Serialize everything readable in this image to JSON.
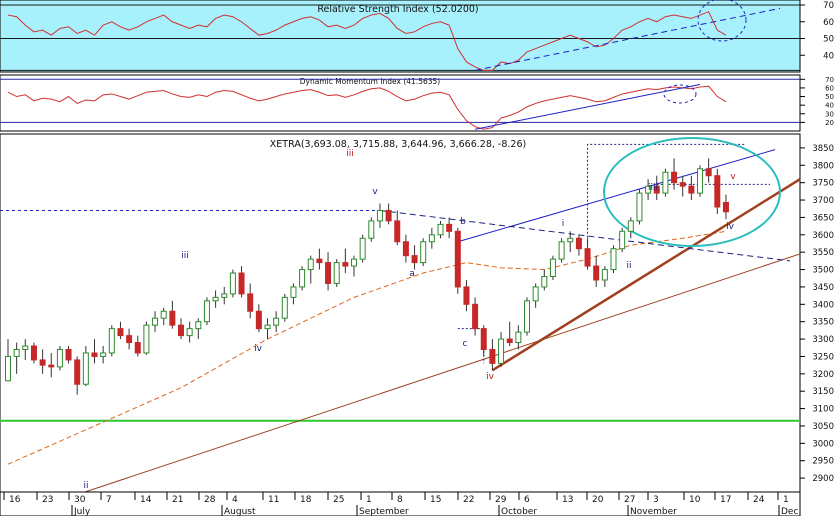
{
  "rsi_panel": {
    "title": "Relative Strength Index (52.0200)",
    "ticks": [
      70,
      60,
      50,
      40
    ]
  },
  "dmi_panel": {
    "title": "Dynamic Momentum Index (41.5635)",
    "ticks": [
      70,
      60,
      50,
      40,
      30,
      20
    ]
  },
  "price_panel": {
    "title": "XETRA(3,693.08, 3,715.88, 3,644.96, 3,666.28, -8.26)",
    "ticks": [
      3850,
      3800,
      3750,
      3700,
      3650,
      3600,
      3550,
      3500,
      3450,
      3400,
      3350,
      3300,
      3250,
      3200,
      3150,
      3100,
      3050,
      3000,
      2950,
      2900
    ]
  },
  "date_axis": {
    "days": [
      "16",
      "23",
      "30",
      "7",
      "14",
      "21",
      "28",
      "4",
      "11",
      "18",
      "25",
      "1",
      "8",
      "15",
      "22",
      "29",
      "6",
      "13",
      "20",
      "27",
      "3",
      "10",
      "17",
      "24",
      "1"
    ],
    "months": [
      "July",
      "August",
      "September",
      "October",
      "November",
      "Dec"
    ]
  },
  "wave_labels": [
    {
      "text": "ii",
      "color": "#1a237e"
    },
    {
      "text": "iii",
      "color": "#1a237e"
    },
    {
      "text": "iv",
      "color": "#1a237e"
    },
    {
      "text": "iii",
      "color": "#b71c1c"
    },
    {
      "text": "v",
      "color": "#1a237e"
    },
    {
      "text": "a",
      "color": "#1a237e"
    },
    {
      "text": "b",
      "color": "#1a237e"
    },
    {
      "text": "c",
      "color": "#1a237e"
    },
    {
      "text": "iv",
      "color": "#b71c1c"
    },
    {
      "text": "i",
      "color": "#1a237e"
    },
    {
      "text": "ii",
      "color": "#1a237e"
    },
    {
      "text": "iiii",
      "color": "#1a237e"
    },
    {
      "text": "v",
      "color": "#b71c1c"
    },
    {
      "text": "iv",
      "color": "#1a237e"
    }
  ],
  "colors": {
    "rsi_bg": "#a7f1fc",
    "price_bg": "#ffffff",
    "bull": "#2e8b2e",
    "bear": "#c62828",
    "indicator_line": "#d32f2f",
    "trend_blue": "#1f1fc8",
    "trend_brown": "#a0401e",
    "support_green": "#2ec82e",
    "ellipse": "#2bbdbd"
  },
  "chart_data": {
    "type": "candlestick",
    "title": "XETRA(3,693.08, 3,715.88, 3,644.96, 3,666.28, -8.26)",
    "ylim": [
      2860,
      3890
    ],
    "x_range": [
      "16 Jul",
      "1 Dec"
    ],
    "ohlc": [
      {
        "o": 3180,
        "h": 3300,
        "l": 3180,
        "c": 3250
      },
      {
        "o": 3250,
        "h": 3290,
        "l": 3200,
        "c": 3270
      },
      {
        "o": 3270,
        "h": 3300,
        "l": 3240,
        "c": 3280
      },
      {
        "o": 3280,
        "h": 3290,
        "l": 3230,
        "c": 3240
      },
      {
        "o": 3240,
        "h": 3270,
        "l": 3200,
        "c": 3225
      },
      {
        "o": 3225,
        "h": 3260,
        "l": 3190,
        "c": 3220
      },
      {
        "o": 3220,
        "h": 3280,
        "l": 3210,
        "c": 3270
      },
      {
        "o": 3270,
        "h": 3280,
        "l": 3230,
        "c": 3240
      },
      {
        "o": 3240,
        "h": 3250,
        "l": 3140,
        "c": 3170
      },
      {
        "o": 3170,
        "h": 3280,
        "l": 3165,
        "c": 3260
      },
      {
        "o": 3260,
        "h": 3300,
        "l": 3230,
        "c": 3250
      },
      {
        "o": 3250,
        "h": 3280,
        "l": 3230,
        "c": 3260
      },
      {
        "o": 3260,
        "h": 3340,
        "l": 3250,
        "c": 3330
      },
      {
        "o": 3330,
        "h": 3350,
        "l": 3300,
        "c": 3310
      },
      {
        "o": 3310,
        "h": 3330,
        "l": 3270,
        "c": 3290
      },
      {
        "o": 3290,
        "h": 3310,
        "l": 3250,
        "c": 3260
      },
      {
        "o": 3260,
        "h": 3350,
        "l": 3255,
        "c": 3340
      },
      {
        "o": 3340,
        "h": 3380,
        "l": 3320,
        "c": 3360
      },
      {
        "o": 3360,
        "h": 3390,
        "l": 3340,
        "c": 3380
      },
      {
        "o": 3380,
        "h": 3410,
        "l": 3330,
        "c": 3340
      },
      {
        "o": 3340,
        "h": 3360,
        "l": 3300,
        "c": 3310
      },
      {
        "o": 3310,
        "h": 3350,
        "l": 3290,
        "c": 3330
      },
      {
        "o": 3330,
        "h": 3360,
        "l": 3300,
        "c": 3350
      },
      {
        "o": 3350,
        "h": 3420,
        "l": 3340,
        "c": 3410
      },
      {
        "o": 3410,
        "h": 3440,
        "l": 3390,
        "c": 3420
      },
      {
        "o": 3420,
        "h": 3450,
        "l": 3400,
        "c": 3430
      },
      {
        "o": 3430,
        "h": 3500,
        "l": 3420,
        "c": 3490
      },
      {
        "o": 3490,
        "h": 3510,
        "l": 3420,
        "c": 3430
      },
      {
        "o": 3430,
        "h": 3460,
        "l": 3360,
        "c": 3380
      },
      {
        "o": 3380,
        "h": 3400,
        "l": 3320,
        "c": 3330
      },
      {
        "o": 3330,
        "h": 3360,
        "l": 3300,
        "c": 3340
      },
      {
        "o": 3340,
        "h": 3380,
        "l": 3320,
        "c": 3360
      },
      {
        "o": 3360,
        "h": 3430,
        "l": 3350,
        "c": 3420
      },
      {
        "o": 3420,
        "h": 3460,
        "l": 3400,
        "c": 3450
      },
      {
        "o": 3450,
        "h": 3510,
        "l": 3440,
        "c": 3500
      },
      {
        "o": 3500,
        "h": 3540,
        "l": 3460,
        "c": 3530
      },
      {
        "o": 3530,
        "h": 3560,
        "l": 3500,
        "c": 3520
      },
      {
        "o": 3520,
        "h": 3550,
        "l": 3440,
        "c": 3460
      },
      {
        "o": 3460,
        "h": 3530,
        "l": 3450,
        "c": 3520
      },
      {
        "o": 3520,
        "h": 3560,
        "l": 3490,
        "c": 3510
      },
      {
        "o": 3510,
        "h": 3540,
        "l": 3480,
        "c": 3530
      },
      {
        "o": 3530,
        "h": 3600,
        "l": 3520,
        "c": 3590
      },
      {
        "o": 3590,
        "h": 3650,
        "l": 3580,
        "c": 3640
      },
      {
        "o": 3640,
        "h": 3690,
        "l": 3620,
        "c": 3670
      },
      {
        "o": 3670,
        "h": 3690,
        "l": 3630,
        "c": 3640
      },
      {
        "o": 3640,
        "h": 3670,
        "l": 3570,
        "c": 3580
      },
      {
        "o": 3580,
        "h": 3600,
        "l": 3520,
        "c": 3540
      },
      {
        "o": 3540,
        "h": 3570,
        "l": 3500,
        "c": 3520
      },
      {
        "o": 3520,
        "h": 3590,
        "l": 3510,
        "c": 3580
      },
      {
        "o": 3580,
        "h": 3620,
        "l": 3560,
        "c": 3600
      },
      {
        "o": 3600,
        "h": 3640,
        "l": 3590,
        "c": 3630
      },
      {
        "o": 3630,
        "h": 3650,
        "l": 3590,
        "c": 3610
      },
      {
        "o": 3610,
        "h": 3620,
        "l": 3430,
        "c": 3450
      },
      {
        "o": 3450,
        "h": 3470,
        "l": 3380,
        "c": 3400
      },
      {
        "o": 3400,
        "h": 3420,
        "l": 3310,
        "c": 3330
      },
      {
        "o": 3330,
        "h": 3340,
        "l": 3250,
        "c": 3270
      },
      {
        "o": 3270,
        "h": 3300,
        "l": 3210,
        "c": 3230
      },
      {
        "o": 3230,
        "h": 3320,
        "l": 3220,
        "c": 3300
      },
      {
        "o": 3300,
        "h": 3350,
        "l": 3280,
        "c": 3290
      },
      {
        "o": 3290,
        "h": 3340,
        "l": 3270,
        "c": 3320
      },
      {
        "o": 3320,
        "h": 3420,
        "l": 3310,
        "c": 3410
      },
      {
        "o": 3410,
        "h": 3460,
        "l": 3390,
        "c": 3450
      },
      {
        "o": 3450,
        "h": 3500,
        "l": 3440,
        "c": 3480
      },
      {
        "o": 3480,
        "h": 3540,
        "l": 3470,
        "c": 3530
      },
      {
        "o": 3530,
        "h": 3590,
        "l": 3520,
        "c": 3580
      },
      {
        "o": 3580,
        "h": 3610,
        "l": 3550,
        "c": 3590
      },
      {
        "o": 3590,
        "h": 3600,
        "l": 3540,
        "c": 3560
      },
      {
        "o": 3560,
        "h": 3590,
        "l": 3500,
        "c": 3510
      },
      {
        "o": 3510,
        "h": 3540,
        "l": 3450,
        "c": 3470
      },
      {
        "o": 3470,
        "h": 3510,
        "l": 3450,
        "c": 3500
      },
      {
        "o": 3500,
        "h": 3570,
        "l": 3490,
        "c": 3560
      },
      {
        "o": 3560,
        "h": 3620,
        "l": 3550,
        "c": 3610
      },
      {
        "o": 3610,
        "h": 3650,
        "l": 3590,
        "c": 3640
      },
      {
        "o": 3640,
        "h": 3730,
        "l": 3630,
        "c": 3720
      },
      {
        "o": 3720,
        "h": 3760,
        "l": 3700,
        "c": 3740
      },
      {
        "o": 3740,
        "h": 3770,
        "l": 3700,
        "c": 3720
      },
      {
        "o": 3720,
        "h": 3790,
        "l": 3710,
        "c": 3780
      },
      {
        "o": 3780,
        "h": 3820,
        "l": 3730,
        "c": 3750
      },
      {
        "o": 3750,
        "h": 3770,
        "l": 3710,
        "c": 3740
      },
      {
        "o": 3740,
        "h": 3770,
        "l": 3700,
        "c": 3720
      },
      {
        "o": 3720,
        "h": 3800,
        "l": 3710,
        "c": 3790
      },
      {
        "o": 3790,
        "h": 3820,
        "l": 3750,
        "c": 3770
      },
      {
        "o": 3770,
        "h": 3790,
        "l": 3660,
        "c": 3680
      },
      {
        "o": 3693.08,
        "h": 3715.88,
        "l": 3644.96,
        "c": 3666.28
      }
    ],
    "moving_average": [
      [
        0,
        2940
      ],
      [
        10,
        3050
      ],
      [
        20,
        3160
      ],
      [
        30,
        3300
      ],
      [
        40,
        3420
      ],
      [
        48,
        3490
      ],
      [
        53,
        3520
      ],
      [
        57,
        3505
      ],
      [
        62,
        3500
      ],
      [
        67,
        3530
      ],
      [
        72,
        3570
      ],
      [
        78,
        3590
      ],
      [
        83,
        3610
      ]
    ],
    "rsi": {
      "ylim": [
        30,
        73
      ],
      "ticks": [
        70,
        60,
        50,
        40
      ],
      "values": [
        64,
        63,
        58,
        54,
        55,
        52,
        56,
        57,
        53,
        55,
        52,
        58,
        60,
        57,
        55,
        57,
        60,
        62,
        64,
        60,
        58,
        56,
        58,
        57,
        62,
        64,
        63,
        60,
        56,
        52,
        53,
        55,
        58,
        60,
        62,
        63,
        61,
        57,
        58,
        56,
        58,
        62,
        64,
        65,
        62,
        56,
        53,
        54,
        57,
        59,
        60,
        58,
        44,
        36,
        33,
        31,
        31,
        36,
        35,
        37,
        42,
        44,
        46,
        48,
        50,
        52,
        50,
        48,
        45,
        46,
        50,
        55,
        57,
        60,
        62,
        60,
        63,
        64,
        63,
        62,
        64,
        66,
        55,
        52
      ]
    },
    "dmi": {
      "ylim": [
        10,
        75
      ],
      "ticks": [
        70,
        60,
        50,
        40,
        30,
        20
      ],
      "values": [
        55,
        50,
        52,
        45,
        48,
        47,
        44,
        50,
        42,
        46,
        45,
        52,
        53,
        50,
        47,
        51,
        55,
        56,
        57,
        53,
        50,
        49,
        52,
        50,
        55,
        57,
        56,
        52,
        48,
        45,
        47,
        50,
        53,
        55,
        57,
        58,
        55,
        51,
        52,
        49,
        52,
        56,
        59,
        60,
        56,
        50,
        45,
        47,
        51,
        54,
        55,
        52,
        35,
        22,
        15,
        12,
        14,
        25,
        28,
        32,
        38,
        42,
        45,
        47,
        49,
        51,
        49,
        47,
        44,
        45,
        49,
        53,
        55,
        57,
        59,
        58,
        60,
        61,
        60,
        59,
        61,
        62,
        50,
        44
      ]
    },
    "support_level": 3065,
    "resistance_level": 3670
  }
}
